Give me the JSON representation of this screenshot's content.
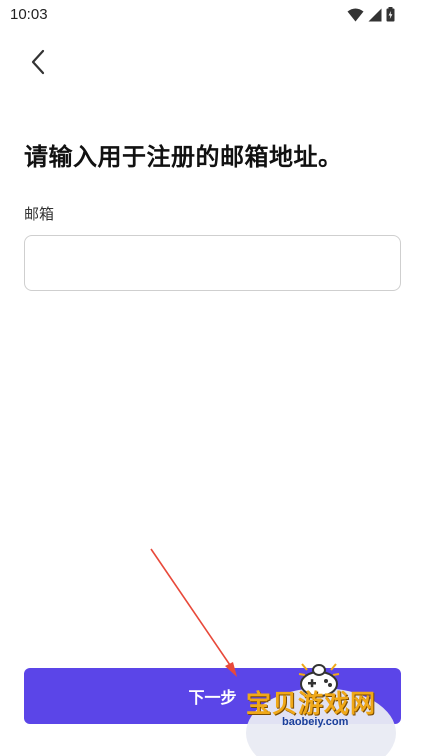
{
  "status_bar": {
    "time": "10:03"
  },
  "header": {
    "back_icon": "chevron-left-icon"
  },
  "main": {
    "title": "请输入用于注册的邮箱地址。",
    "email_label": "邮箱",
    "email_value": "",
    "email_placeholder": ""
  },
  "footer": {
    "next_label": "下一步"
  },
  "watermark": {
    "text": "宝贝游戏网",
    "url": "baobeiy.com"
  },
  "colors": {
    "accent": "#5b45e8",
    "annotation_arrow": "#e8493a",
    "watermark_text": "#f0a818"
  }
}
